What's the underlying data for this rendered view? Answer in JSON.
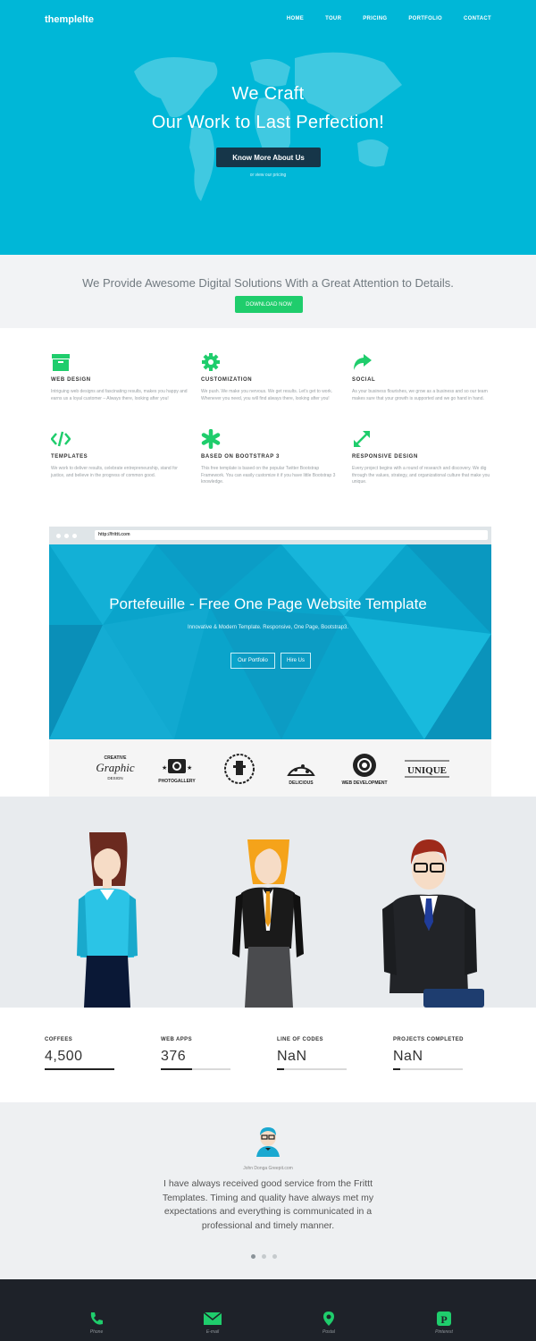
{
  "brand": "themplelte",
  "nav": [
    "HOME",
    "TOUR",
    "PRICING",
    "PORTFOLIO",
    "CONTACT"
  ],
  "hero": {
    "line1": "We Craft",
    "line2": "Our Work to Last Perfection!",
    "cta": "Know More About Us",
    "sub": "or view our pricing"
  },
  "provide": {
    "text": "We Provide Awesome Digital Solutions With a Great Attention to Details.",
    "button": "DOWNLOAD NOW"
  },
  "features": [
    {
      "icon": "box-icon",
      "title": "WEB DESIGN",
      "text": "Intriguing web designs and fascinating results, makes you happy and earns us a loyal customer – Always there, looking after you!"
    },
    {
      "icon": "gear-icon",
      "title": "CUSTOMIZATION",
      "text": "We push. We make you nervous. We get results. Let's get to work. Whenever you need, you will find always there, looking after you!"
    },
    {
      "icon": "share-icon",
      "title": "SOCIAL",
      "text": "As your business flourishes, we grow as a business and so our team makes sure that your growth is supported and we go hand in hand."
    },
    {
      "icon": "code-icon",
      "title": "TEMPLATES",
      "text": "We work to deliver results, celebrate entrepreneurship, stand for justice, and believe in the progress of common good."
    },
    {
      "icon": "asterisk-icon",
      "title": "BASED ON BOOTSTRAP 3",
      "text": "This free template is based on the popular Twitter Bootstrap Framework. You can easily customize it if you have little Bootstrap 3 knowledge."
    },
    {
      "icon": "expand-icon",
      "title": "RESPONSIVE DESIGN",
      "text": "Every project begins with a round of research and discovery. We dig through the values, strategy, and organizational culture that make you unique."
    }
  ],
  "browser": {
    "url": "http://frittt.com",
    "title": "Portefeuille - Free One Page Website Template",
    "subtitle": "Innovative & Modern Template. Responsive, One Page, Bootstrap3.",
    "btn1": "Our Portfolio",
    "btn2": "Hire Us"
  },
  "logos": [
    "Creative Graphic Design",
    "PHOTOGALLERY",
    "",
    "DELICIOUS",
    "WEB DEVELOPMENT",
    "UNIQUE"
  ],
  "stats": [
    {
      "label": "COFFEES",
      "value": "4,500",
      "progress": 1.0
    },
    {
      "label": "WEB APPS",
      "value": "376",
      "progress": 0.45
    },
    {
      "label": "LINE OF CODES",
      "value": "NaN",
      "progress": 0.1
    },
    {
      "label": "PROJECTS COMPLETED",
      "value": "NaN",
      "progress": 0.1
    }
  ],
  "testimonial": {
    "author": "John Donga    Greepit.com",
    "quote": "I have always received good service from the Frittt Templates. Timing and quality have always met my expectations and everything is communicated in a professional and timely manner."
  },
  "footer": [
    {
      "icon": "phone-icon",
      "label": "Phone"
    },
    {
      "icon": "email-icon",
      "label": "E-mail"
    },
    {
      "icon": "map-pin-icon",
      "label": "Postal"
    },
    {
      "icon": "pinterest-icon",
      "label": "Pinterest"
    }
  ],
  "colors": {
    "accent": "#00b7d7",
    "green": "#1fcd6c",
    "dark": "#1e2229"
  }
}
